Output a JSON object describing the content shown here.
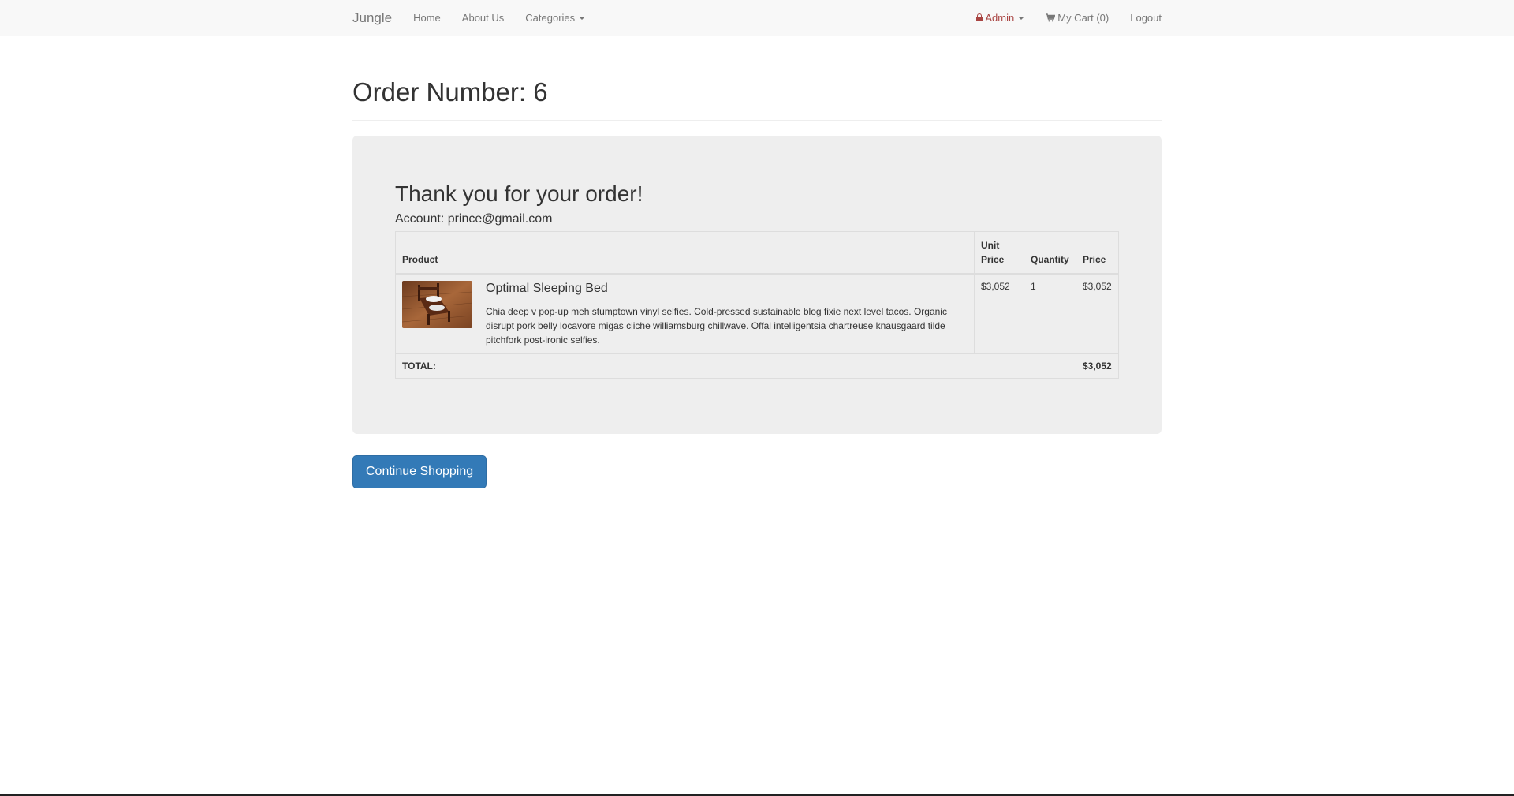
{
  "navbar": {
    "brand": "Jungle",
    "home": "Home",
    "about": "About Us",
    "categories": "Categories",
    "admin": "Admin",
    "cart": "My Cart (0)",
    "logout": "Logout"
  },
  "page": {
    "title": "Order Number: 6"
  },
  "order": {
    "thanks": "Thank you for your order!",
    "account": "Account: prince@gmail.com",
    "table": {
      "headers": {
        "product": "Product",
        "unit_price": "Unit Price",
        "quantity": "Quantity",
        "price": "Price"
      },
      "items": [
        {
          "name": "Optimal Sleeping Bed",
          "description": "Chia deep v pop-up meh stumptown vinyl selfies. Cold-pressed sustainable blog fixie next level tacos. Organic disrupt pork belly locavore migas cliche williamsburg chillwave. Offal intelligentsia chartreuse knausgaard tilde pitchfork post-ironic selfies.",
          "unit_price": "$3,052",
          "quantity": "1",
          "price": "$3,052",
          "image": "bed-photo"
        }
      ],
      "total_label": "TOTAL:",
      "total_value": "$3,052"
    }
  },
  "actions": {
    "continue": "Continue Shopping"
  },
  "icons": {
    "admin": "lock-icon",
    "cart": "cart-icon"
  },
  "colors": {
    "primary": "#337ab7",
    "admin": "#a94442",
    "jumbotron": "#eeeeee"
  }
}
